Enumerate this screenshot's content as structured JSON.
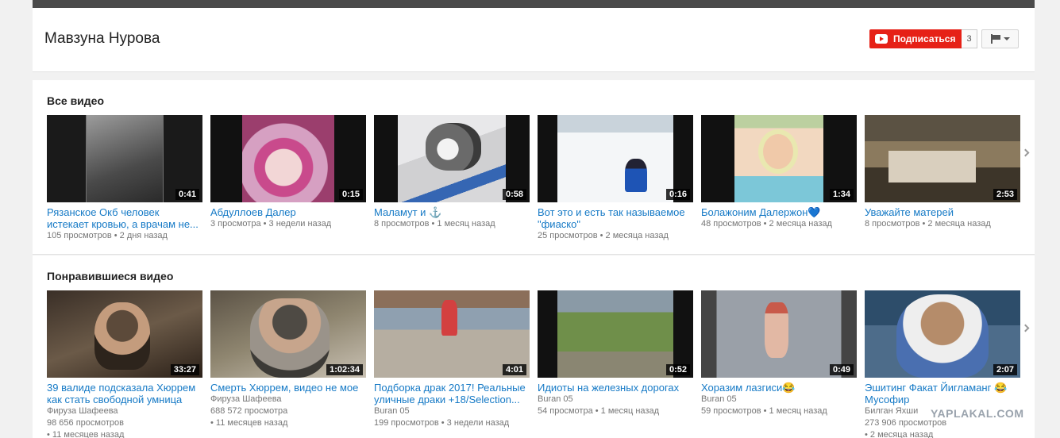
{
  "channel": {
    "name": "Мавзуна Нурова",
    "subscribe_label": "Подписаться",
    "subscriber_count": "3"
  },
  "sections": [
    {
      "title": "Все видео",
      "videos": [
        {
          "title": "Рязанское Окб человек истекает кровью, а врачам не...",
          "duration": "0:41",
          "views": "105 просмотров",
          "age": "2 дня назад"
        },
        {
          "title": "Абдуллоев Далер",
          "duration": "0:15",
          "views": "3 просмотра",
          "age": "3 недели назад"
        },
        {
          "title": "Маламут и ⚓",
          "duration": "0:58",
          "views": "8 просмотров",
          "age": "1 месяц назад"
        },
        {
          "title": "Вот это и есть так называемое \"фиаско\"",
          "duration": "0:16",
          "views": "25 просмотров",
          "age": "2 месяца назад"
        },
        {
          "title": "Болажоним Далержон💙",
          "duration": "1:34",
          "views": "48 просмотров",
          "age": "2 месяца назад"
        },
        {
          "title": "Уважайте матерей",
          "duration": "2:53",
          "views": "8 просмотров",
          "age": "2 месяца назад"
        }
      ]
    },
    {
      "title": "Понравившиеся видео",
      "videos": [
        {
          "title": "39 валиде подсказала Хюррем как стать свободной умница",
          "duration": "33:27",
          "author": "Фируза Шафеева",
          "views": "98 656 просмотров",
          "age": "11 месяцев назад"
        },
        {
          "title": "Смерть Хюррем, видео не мое",
          "duration": "1:02:34",
          "author": "Фируза Шафеева",
          "views": "688 572 просмотра",
          "age": "11 месяцев назад"
        },
        {
          "title": "Подборка драк 2017! Реальные уличные драки +18/Selection...",
          "duration": "4:01",
          "author": "Buran 05",
          "views": "199 просмотров",
          "age": "3 недели назад"
        },
        {
          "title": "Идиоты на железных дорогах",
          "duration": "0:52",
          "author": "Buran 05",
          "views": "54 просмотра",
          "age": "1 месяц назад"
        },
        {
          "title": "Хоразим лазгиси😂",
          "duration": "0:49",
          "author": "Buran 05",
          "views": "59 просмотров",
          "age": "1 месяц назад"
        },
        {
          "title": "Эшитинг Факат Йигламанг 😂 Мусофир",
          "duration": "2:07",
          "author": "Билган Яхши",
          "views": "273 906 просмотров",
          "age": "2 месяца назад"
        }
      ]
    }
  ],
  "watermark": "YAPLAKAL.COM",
  "icons": {
    "play": "youtube-play-icon",
    "flag": "flag-icon",
    "caret": "caret-down-icon",
    "next": "chevron-right-icon"
  }
}
